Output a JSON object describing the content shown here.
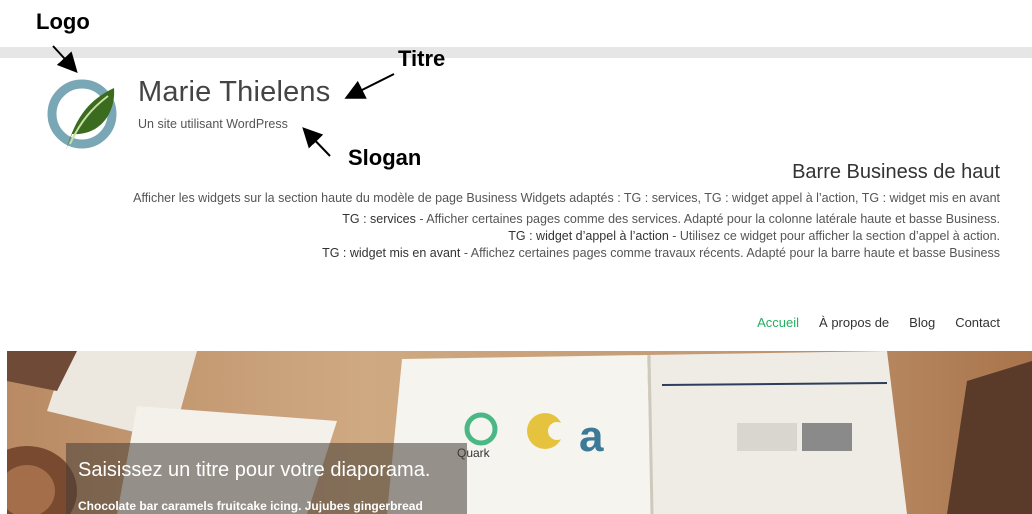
{
  "annotations": {
    "logo": "Logo",
    "titre": "Titre",
    "slogan": "Slogan"
  },
  "site": {
    "title": "Marie Thielens",
    "tagline": "Un site utilisant WordPress"
  },
  "business_bar": {
    "title": "Barre Business de haut",
    "description": "Afficher les widgets sur la section haute du modèle de page Business Widgets adaptés : TG : services, TG : widget appel à l’action, TG : widget mis en avant",
    "lines": [
      {
        "label": "TG : services",
        "text": " - Afficher certaines pages comme des services. Adapté pour la colonne latérale haute et basse Business."
      },
      {
        "label": "TG : widget d’appel à l’action",
        "text": " - Utilisez ce widget pour afficher la section d’appel à action."
      },
      {
        "label": "TG : widget mis en avant",
        "text": " - Affichez certaines pages comme travaux récents. Adapté pour la barre haute et basse Business"
      }
    ]
  },
  "nav": {
    "items": [
      "Accueil",
      "À propos de",
      "Blog",
      "Contact"
    ],
    "active": "Accueil"
  },
  "hero": {
    "title": "Saisissez un titre pour votre diaporama.",
    "text": "Chocolate bar caramels fruitcake icing. Jujubes gingerbread",
    "quark_label": "Quark"
  },
  "colors": {
    "accent": "#27ae60",
    "frame": "#e6e6e6",
    "logo_ring": "#7aa7b5",
    "logo_leaf": "#3a6b1f"
  }
}
